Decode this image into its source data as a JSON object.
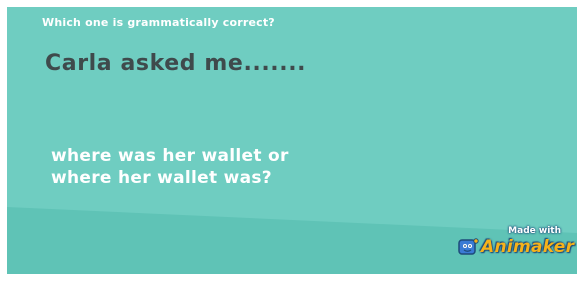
{
  "slide": {
    "question": "Which one is grammatically correct?",
    "prompt": "Carla asked me.......",
    "option_line_1": "where was her wallet or",
    "option_line_2": "where her wallet was?"
  },
  "watermark": {
    "made_with": "Made with",
    "brand": "Animaker",
    "icon": "animaker-logo-icon"
  },
  "colors": {
    "background": "#6fcdc1",
    "lower_band": "#5fc3b6",
    "prompt_text": "#3f4a4c",
    "brand_text": "#f6b21a"
  }
}
